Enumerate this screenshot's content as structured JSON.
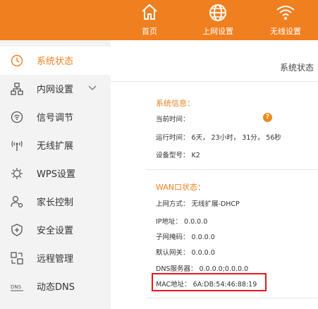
{
  "topnav": {
    "items": [
      {
        "label": "首页",
        "icon": "home-icon"
      },
      {
        "label": "上网设置",
        "icon": "globe-icon"
      },
      {
        "label": "无线设置",
        "icon": "wifi-icon"
      }
    ]
  },
  "sidebar": {
    "items": [
      {
        "label": "系统状态",
        "icon": "clock-icon",
        "active": true
      },
      {
        "label": "内网设置",
        "icon": "network-icon",
        "expandable": true
      },
      {
        "label": "信号调节",
        "icon": "signal-icon"
      },
      {
        "label": "无线扩展",
        "icon": "wireless-extend-icon"
      },
      {
        "label": "WPS设置",
        "icon": "wps-gear-icon"
      },
      {
        "label": "家长控制",
        "icon": "parent-icon"
      },
      {
        "label": "安全设置",
        "icon": "shield-icon"
      },
      {
        "label": "远程管理",
        "icon": "remote-icon"
      },
      {
        "label": "动态DNS",
        "icon": "dns-icon"
      }
    ]
  },
  "main": {
    "page_title": "系统状态",
    "system_info": {
      "title": "系统信息：",
      "current_time_label": "当前时间：",
      "uptime": "运行时间： 6天， 23小时， 31分， 56秒",
      "model": "设备型号： K2"
    },
    "wan_status": {
      "title": "WAN口状态：",
      "connection_type": "上网方式： 无线扩展-DHCP",
      "ip": "IP地址： 0.0.0.0",
      "subnet": "子网掩码： 0.0.0.0",
      "gateway": "默认网关： 0.0.0.0",
      "dns": "DNS服务器： 0.0.0.0;0.0.0.0",
      "mac": "MAC地址： 6A:DB:54:46:88:19"
    }
  },
  "colors": {
    "accent": "#f07f1f",
    "highlight_box": "#e8171b"
  }
}
